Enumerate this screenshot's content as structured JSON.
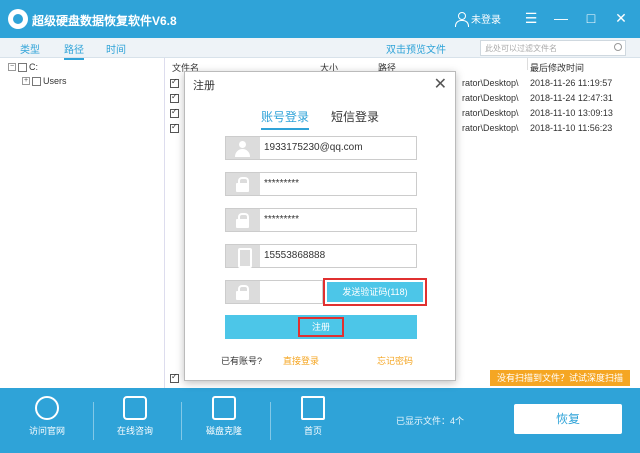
{
  "app": {
    "title": "超级硬盘数据恢复软件V6.8",
    "login_label": "未登录"
  },
  "window": {
    "minimize": "—",
    "restore": "☐",
    "maximize": "□",
    "close": "✕",
    "menu": "☰"
  },
  "tabs": [
    {
      "label": "类型"
    },
    {
      "label": "路径"
    },
    {
      "label": "时间"
    }
  ],
  "toolbar": {
    "hint": "双击预览文件",
    "search_placeholder": "此处可以过滤文件名"
  },
  "tree": {
    "drive": "C:",
    "folder": "Users"
  },
  "table": {
    "headers": {
      "name": "文件名",
      "size": "大小",
      "path": "路径",
      "modified": "最后修改时间"
    },
    "rows": [
      {
        "path": "rator\\Desktop\\",
        "date": "2018-11-26 11:19:57"
      },
      {
        "path": "rator\\Desktop\\",
        "date": "2018-11-24 12:47:31"
      },
      {
        "path": "rator\\Desktop\\",
        "date": "2018-11-10 13:09:13"
      },
      {
        "path": "rator\\Desktop\\",
        "date": "2018-11-10 11:56:23"
      }
    ]
  },
  "deep_scan": "没有扫描到文件？试试深度扫描",
  "footer": {
    "items": [
      {
        "label": "访问官网"
      },
      {
        "label": "在线咨询"
      },
      {
        "label": "磁盘克隆"
      },
      {
        "label": "首页"
      }
    ],
    "shown_files": "已显示文件：4个",
    "recover": "恢复"
  },
  "dialog": {
    "title": "注册",
    "close": "✕",
    "tab_account": "账号登录",
    "tab_sms": "短信登录",
    "email": "1933175230@qq.com",
    "password": "*********",
    "confirm_password": "*********",
    "phone": "15553868888",
    "code": "",
    "send_code": "发送验证码(118)",
    "register": "注册",
    "have_account": "已有账号?",
    "login_now": "直接登录",
    "forgot": "忘记密码"
  },
  "colors": {
    "primary": "#2fa3d8",
    "accent": "#4cc6e8",
    "orange": "#f5a623",
    "highlight": "#e03030"
  }
}
